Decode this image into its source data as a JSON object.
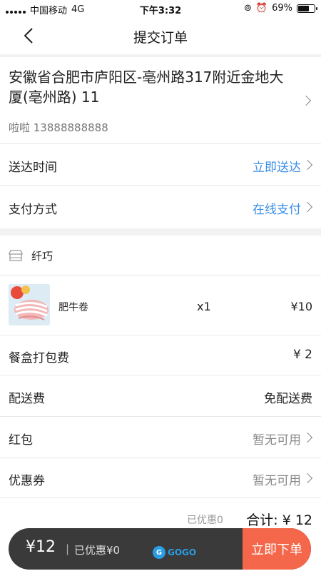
{
  "status_bar": {
    "carrier": "中国移动",
    "network": "4G",
    "time": "下午3:32",
    "battery_percent": "69%",
    "battery_level": 0.69
  },
  "nav": {
    "title": "提交订单",
    "back_icon": "chevron-left-icon"
  },
  "address": {
    "line": "安徽省合肥市庐阳区-亳州路317附近金地大厦(亳州路) 11",
    "contact": "啦啦 13888888888"
  },
  "delivery_time": {
    "label": "送达时间",
    "value": "立即送达"
  },
  "payment": {
    "label": "支付方式",
    "value": "在线支付"
  },
  "shop": {
    "name": "纤巧",
    "icon": "store-icon"
  },
  "item": {
    "name": "肥牛卷",
    "qty": "x1",
    "price": "¥10"
  },
  "fees": [
    {
      "label": "餐盒打包费",
      "value": "¥ 2"
    },
    {
      "label": "配送费",
      "value": "免配送费"
    }
  ],
  "red_packet": {
    "label": "红包",
    "value": "暂无可用"
  },
  "coupon": {
    "label": "优惠券",
    "value": "暂无可用"
  },
  "summary": {
    "discounted": "已优惠0",
    "total": "合计: ¥ 12"
  },
  "bottom_bar": {
    "price": "¥12",
    "separator": "|",
    "discount": "已优惠¥0",
    "submit": "立即下单"
  },
  "watermark": {
    "logo": "G",
    "text": "GOGO"
  },
  "colors": {
    "accent": "#3a8ee6",
    "submit": "#f4674a",
    "bar": "#3a3a3a"
  }
}
